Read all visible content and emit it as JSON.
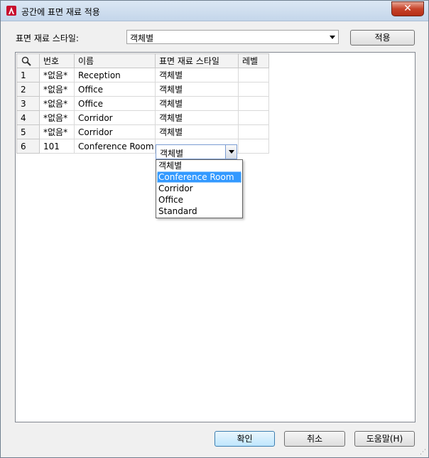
{
  "window": {
    "title": "공간에 표면 재료 적용",
    "close_label": "✕"
  },
  "style_row": {
    "label": "표면 재료 스타일:",
    "combo_value": "객체별",
    "apply_label": "적용"
  },
  "grid": {
    "columns": [
      "",
      "번호",
      "이름",
      "표면 재료 스타일",
      "레벨"
    ],
    "rows": [
      {
        "index": "1",
        "number": "*없음*",
        "name": "Reception",
        "style": "객체별",
        "level": ""
      },
      {
        "index": "2",
        "number": "*없음*",
        "name": "Office",
        "style": "객체별",
        "level": ""
      },
      {
        "index": "3",
        "number": "*없음*",
        "name": "Office",
        "style": "객체별",
        "level": ""
      },
      {
        "index": "4",
        "number": "*없음*",
        "name": "Corridor",
        "style": "객체별",
        "level": ""
      },
      {
        "index": "5",
        "number": "*없음*",
        "name": "Corridor",
        "style": "객체별",
        "level": ""
      },
      {
        "index": "6",
        "number": "101",
        "name": "Conference Room",
        "style": "객체별",
        "level": ""
      }
    ]
  },
  "dropdown": {
    "options": [
      "객체별",
      "Conference Room",
      "Corridor",
      "Office",
      "Standard"
    ],
    "selected_index": 1
  },
  "footer": {
    "ok_label": "확인",
    "cancel_label": "취소",
    "help_label": "도움말(H)"
  },
  "icons": {
    "search": "search-icon",
    "app": "autocad-logo-icon"
  }
}
